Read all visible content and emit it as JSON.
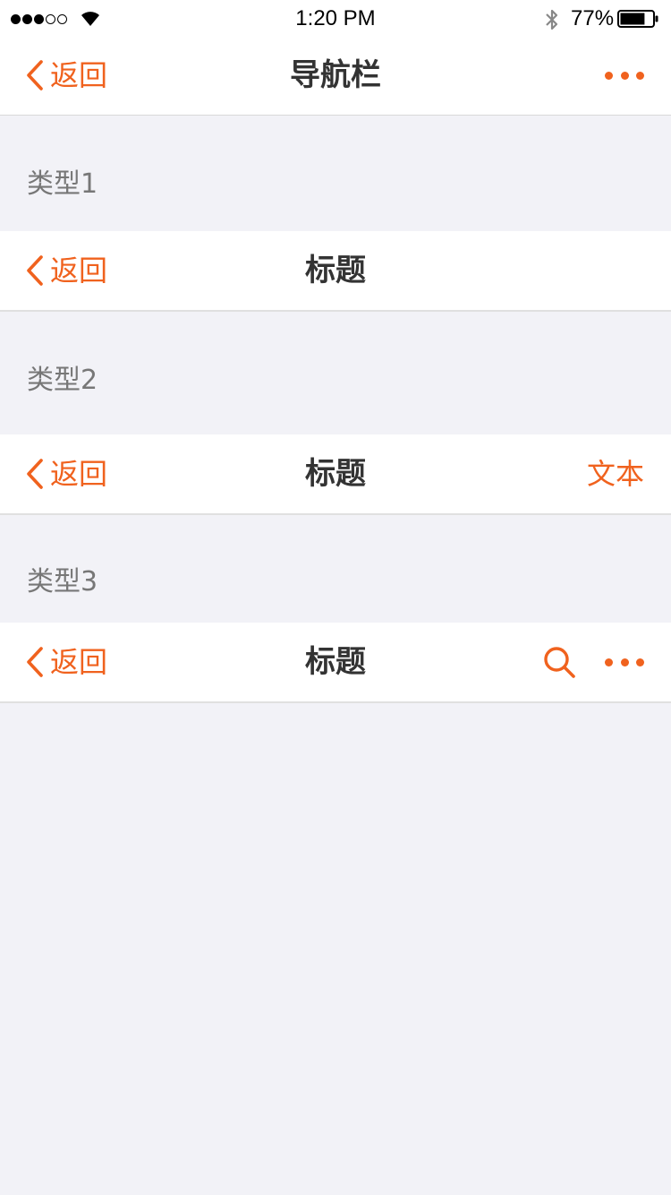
{
  "status_bar": {
    "time": "1:20 PM",
    "battery_percent": "77%",
    "battery_level": 0.77,
    "signal_bars": 3,
    "signal_total": 5
  },
  "navbar": {
    "back_label": "返回",
    "title": "导航栏"
  },
  "sections": [
    {
      "label": "类型1",
      "back_label": "返回",
      "title": "标题"
    },
    {
      "label": "类型2",
      "back_label": "返回",
      "title": "标题",
      "right_text": "文本"
    },
    {
      "label": "类型3",
      "back_label": "返回",
      "title": "标题"
    }
  ],
  "icons": {
    "back": "chevron-left-icon",
    "more": "more-dots-icon",
    "search": "search-icon",
    "wifi": "wifi-icon",
    "bluetooth": "bluetooth-icon",
    "battery": "battery-icon"
  },
  "colors": {
    "accent": "#F0621E",
    "background": "#F2F2F7",
    "title": "#333333",
    "section_label": "#777777"
  }
}
